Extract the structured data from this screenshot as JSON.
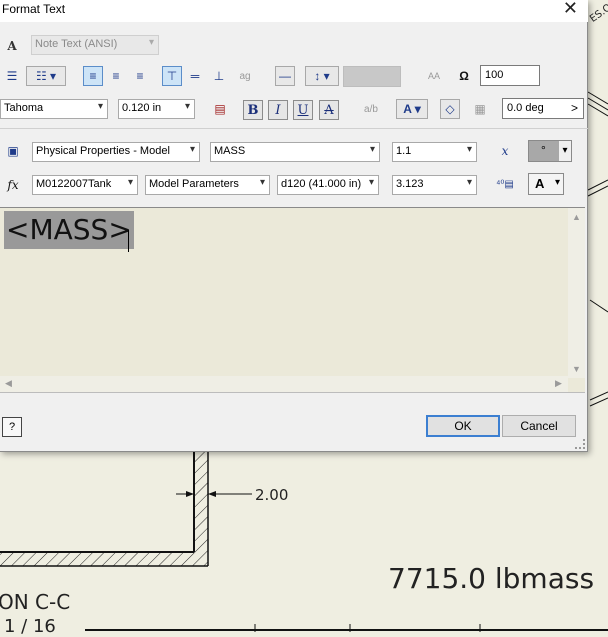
{
  "window": {
    "title": "Format Text",
    "close_glyph": "✕"
  },
  "row1": {
    "style_value": "Note Text (ANSI)",
    "width_value": "100"
  },
  "row2": {
    "font_value": "Tahoma",
    "size_value": "0.120 in",
    "bold": "B",
    "italic": "I",
    "underline": "U",
    "strike": "A",
    "rotation_value": "0.0 deg",
    "rotation_arrow": ">"
  },
  "row3": {
    "type_value": "Physical Properties - Model",
    "property_value": "MASS",
    "precision_value": "1.1",
    "symbol_value": "°"
  },
  "row4": {
    "component_value": "M0122007Tank",
    "source_value": "Model Parameters",
    "parameter_value": "d120 (41.000 in)",
    "param_precision_value": "3.123",
    "case_value": "A"
  },
  "editor": {
    "content": "<MASS>"
  },
  "footer": {
    "help_glyph": "?",
    "ok_label": "OK",
    "cancel_label": "Cancel"
  },
  "drawing": {
    "dimension_text": "2.00",
    "mass_annotation": "7715.0 lbmass",
    "section_text": "ON C-C",
    "scale_text": "1 / 16",
    "corner_text": "ES.O"
  },
  "colors": {
    "dialog_bg": "#f0f0f0",
    "editor_bg": "#ebe9d9",
    "highlight": "#999999",
    "drawing_bg": "#efeee1",
    "accent": "#3c7fd1"
  }
}
